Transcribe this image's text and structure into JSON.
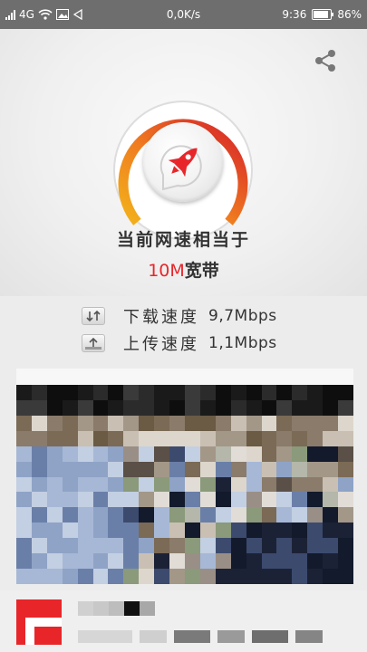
{
  "status_bar": {
    "network": "4G",
    "speed": "0,0K/s",
    "time": "9:36",
    "battery": "86%",
    "battery_level": 0.86
  },
  "app": {
    "headline": "当前网速相当于",
    "equivalent_value": "10M",
    "equivalent_unit": "宽带",
    "accent_color": "#e8262a",
    "share_icon": "share-icon",
    "rocket_icon": "rocket-icon"
  },
  "speeds": [
    {
      "icon": "download-arrows-icon",
      "label": "下载速度",
      "value": "9,7Mbps"
    },
    {
      "icon": "upload-icon",
      "label": "上传速度",
      "value": "1,1Mbps"
    }
  ]
}
